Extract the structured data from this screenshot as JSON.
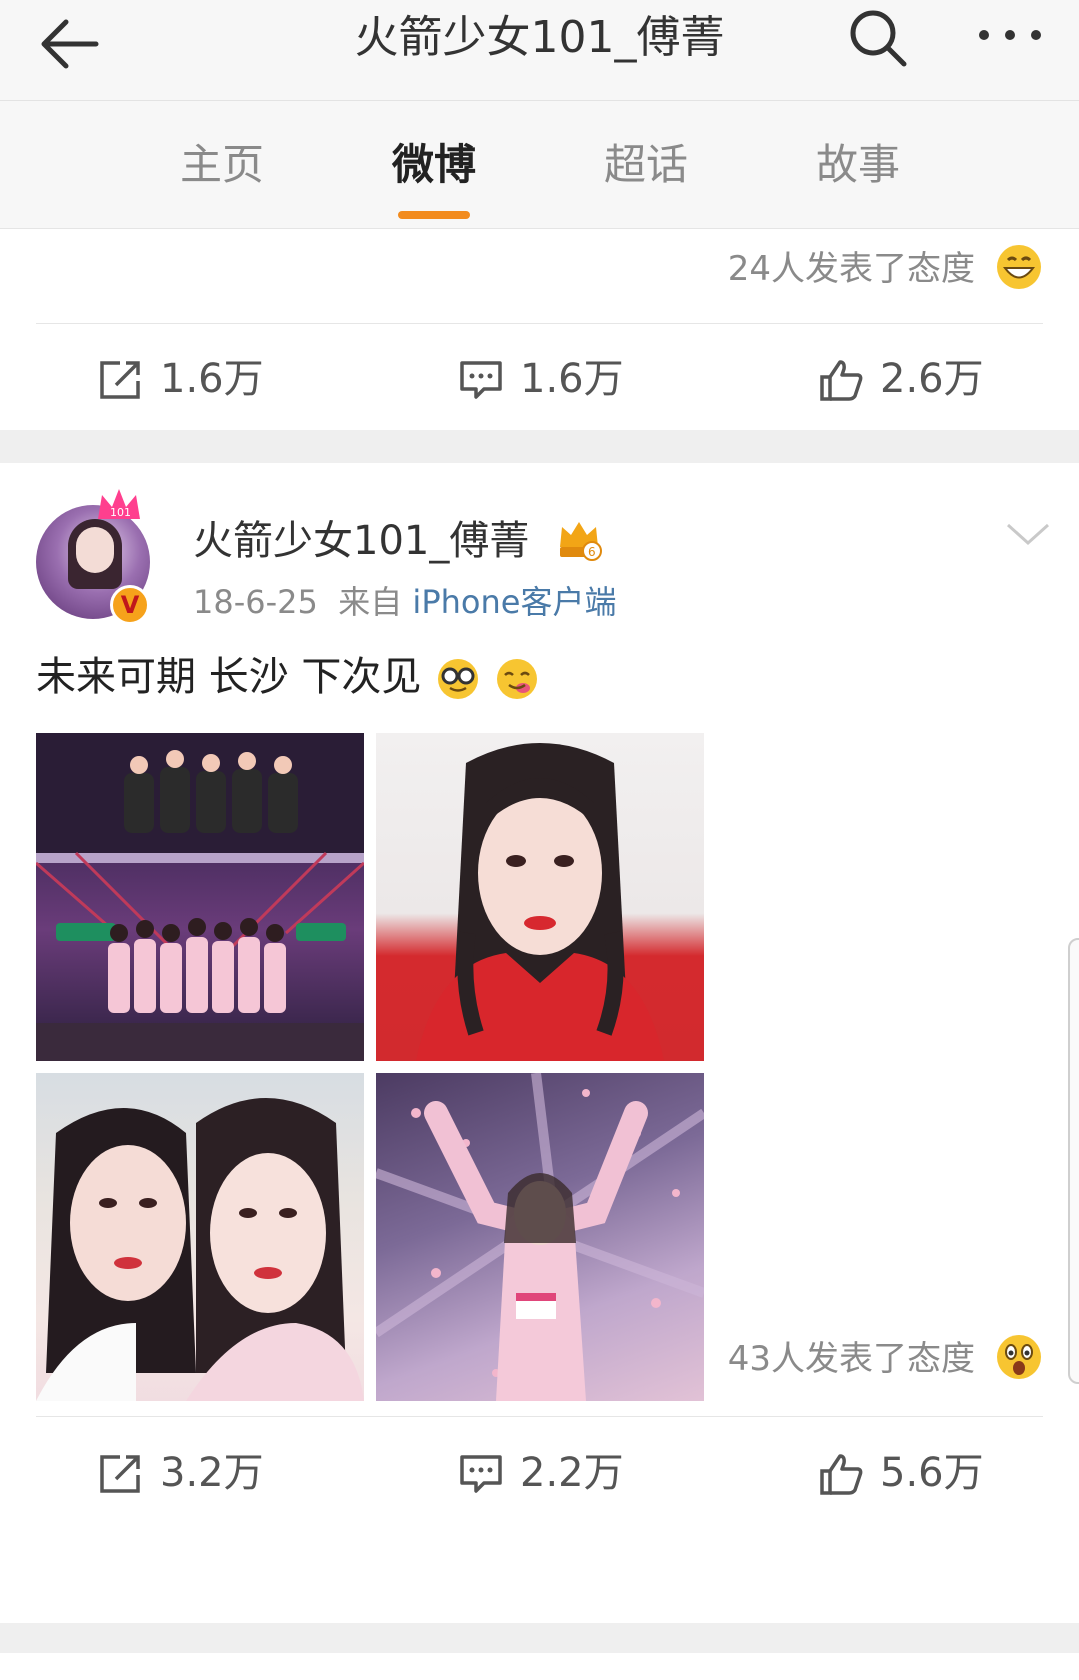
{
  "header": {
    "title": "火箭少女101_傅菁",
    "back_icon": "back-arrow-icon",
    "search_icon": "search-icon",
    "more_icon": "more-dots-icon"
  },
  "tabs": [
    {
      "label": "主页"
    },
    {
      "label": "微博"
    },
    {
      "label": "超话"
    },
    {
      "label": "故事"
    }
  ],
  "active_tab": "微博",
  "accent_color": "#f28b1e",
  "posts": [
    {
      "reactions_text": "24人发表了态度",
      "reaction_emoji": "grin-emoji",
      "actions": {
        "repost": "1.6万",
        "comment": "1.6万",
        "like": "2.6万"
      }
    },
    {
      "username": "火箭少女101_傅菁",
      "date": "18-6-25",
      "source_prefix": "来自",
      "source": "iPhone客户端",
      "text": "未来可期 长沙 下次见",
      "text_emojis": [
        "nerd-glasses-emoji",
        "yum-emoji"
      ],
      "photos": [
        "group-stage-photo",
        "red-jacket-selfie-photo",
        "two-girls-selfie-photo",
        "pink-stage-photo"
      ],
      "reactions_text": "43人发表了态度",
      "reaction_emoji": "surprised-emoji",
      "actions": {
        "repost": "3.2万",
        "comment": "2.2万",
        "like": "5.6万"
      }
    }
  ]
}
